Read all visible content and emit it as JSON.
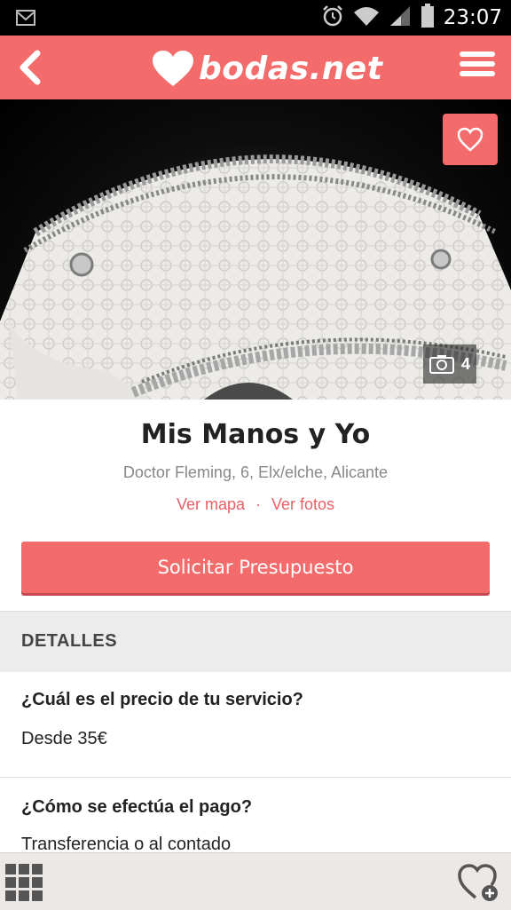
{
  "status_bar": {
    "time": "23:07"
  },
  "header": {
    "logo_text": "bodas.net"
  },
  "vendor": {
    "name": "Mis Manos y Yo",
    "address": "Doctor Fleming, 6, Elx/elche, Alicante",
    "map_link": "Ver mapa",
    "separator": "·",
    "photos_link": "Ver fotos",
    "photo_count": "4"
  },
  "cta": {
    "label": "Solicitar Presupuesto"
  },
  "details": {
    "title": "DETALLES",
    "items": [
      {
        "question": "¿Cuál es el precio de tu servicio?",
        "answer": "Desde 35€"
      },
      {
        "question": "¿Cómo se efectúa el pago?",
        "answer": "Transferencia o al contado"
      }
    ]
  },
  "colors": {
    "brand": "#f36b6b",
    "link": "#e85f66"
  }
}
